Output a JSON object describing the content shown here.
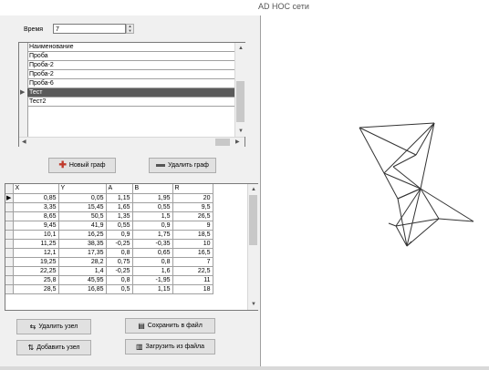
{
  "window": {
    "title": "AD HOC сети"
  },
  "time": {
    "label": "Время",
    "value": "7"
  },
  "names_grid": {
    "header": "Наименование",
    "rows": [
      "Проба",
      "Проба-2",
      "Проба-2",
      "Проба-6",
      "Тест",
      "Тест2"
    ],
    "selected_index": 4
  },
  "graph_buttons": {
    "new": "Новый граф",
    "delete": "Удалить граф"
  },
  "nodes_grid": {
    "columns": [
      "X",
      "Y",
      "A",
      "B",
      "R"
    ],
    "rows": [
      [
        "0,85",
        "0,05",
        "1,15",
        "1,95",
        "20"
      ],
      [
        "3,35",
        "15,45",
        "1,65",
        "0,55",
        "9,5"
      ],
      [
        "8,65",
        "50,5",
        "1,35",
        "1,5",
        "26,5"
      ],
      [
        "9,45",
        "41,9",
        "0,55",
        "0,9",
        "9"
      ],
      [
        "10,1",
        "16,25",
        "0,9",
        "1,75",
        "18,5"
      ],
      [
        "11,25",
        "38,35",
        "-0,25",
        "-0,35",
        "10"
      ],
      [
        "12,1",
        "17,35",
        "0,8",
        "0,65",
        "16,5"
      ],
      [
        "19,25",
        "28,2",
        "0,75",
        "0,8",
        "7"
      ],
      [
        "22,25",
        "1,4",
        "-0,25",
        "1,6",
        "22,5"
      ],
      [
        "25,8",
        "45,95",
        "0,8",
        "-1,95",
        "11"
      ],
      [
        "28,5",
        "16,85",
        "0,5",
        "1,15",
        "18"
      ]
    ]
  },
  "node_buttons": {
    "delete": "Удалить узел",
    "add": "Добавить узел",
    "save": "Сохранить в файл",
    "load": "Загрузить из файла"
  },
  "colors": {
    "panel": "#f0f0f0",
    "selection": "#5a5a5a",
    "border": "#7a7a7a"
  }
}
